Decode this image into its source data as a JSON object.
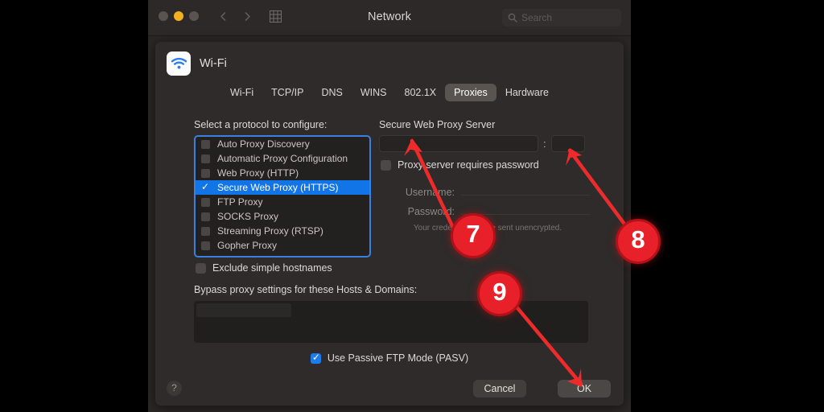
{
  "window": {
    "title": "Network",
    "traffic_lights": [
      "close-button",
      "minimize-button",
      "zoom-button"
    ],
    "search": {
      "placeholder": "Search",
      "value": ""
    },
    "nav": {
      "back": "back-chevron-icon",
      "forward": "forward-chevron-icon",
      "grid": "show-all-grid-icon"
    }
  },
  "interface": {
    "icon": "wifi-icon",
    "name": "Wi-Fi"
  },
  "tabs": [
    {
      "label": "Wi-Fi",
      "selected": false
    },
    {
      "label": "TCP/IP",
      "selected": false
    },
    {
      "label": "DNS",
      "selected": false
    },
    {
      "label": "WINS",
      "selected": false
    },
    {
      "label": "802.1X",
      "selected": false
    },
    {
      "label": "Proxies",
      "selected": true
    },
    {
      "label": "Hardware",
      "selected": false
    }
  ],
  "protocols": {
    "label": "Select a protocol to configure:",
    "items": [
      {
        "name": "Auto Proxy Discovery",
        "checked": false,
        "selected": false
      },
      {
        "name": "Automatic Proxy Configuration",
        "checked": false,
        "selected": false
      },
      {
        "name": "Web Proxy (HTTP)",
        "checked": false,
        "selected": false
      },
      {
        "name": "Secure Web Proxy (HTTPS)",
        "checked": true,
        "selected": true
      },
      {
        "name": "FTP Proxy",
        "checked": false,
        "selected": false
      },
      {
        "name": "SOCKS Proxy",
        "checked": false,
        "selected": false
      },
      {
        "name": "Streaming Proxy (RTSP)",
        "checked": false,
        "selected": false
      },
      {
        "name": "Gopher Proxy",
        "checked": false,
        "selected": false
      }
    ]
  },
  "exclude_simple_hostnames": {
    "label": "Exclude simple hostnames",
    "checked": false
  },
  "bypass": {
    "label": "Bypass proxy settings for these Hosts & Domains:",
    "value": ""
  },
  "passive_ftp": {
    "label": "Use Passive FTP Mode (PASV)",
    "checked": true
  },
  "server": {
    "title": "Secure Web Proxy Server",
    "host": {
      "value": "",
      "placeholder": ""
    },
    "separator": ":",
    "port": {
      "value": "",
      "placeholder": ""
    },
    "requires_password": {
      "label": "Proxy server requires password",
      "checked": false
    },
    "username": {
      "label": "Username:",
      "value": ""
    },
    "password": {
      "label": "Password:",
      "value": ""
    },
    "note": "Your credentials will be sent unencrypted."
  },
  "footer": {
    "help": "?",
    "cancel_label": "Cancel",
    "ok_label": "OK"
  },
  "annotations": {
    "badges": [
      {
        "id": "7",
        "target": "secure-web-proxy-host-field"
      },
      {
        "id": "8",
        "target": "secure-web-proxy-port-field"
      },
      {
        "id": "9",
        "target": "ok-button"
      }
    ],
    "color": "#e8202a"
  },
  "colors": {
    "accent_blue": "#1175e8",
    "focus_ring": "#3b7fe0",
    "annotation_red": "#e8202a",
    "window_bg": "#2a2726"
  }
}
